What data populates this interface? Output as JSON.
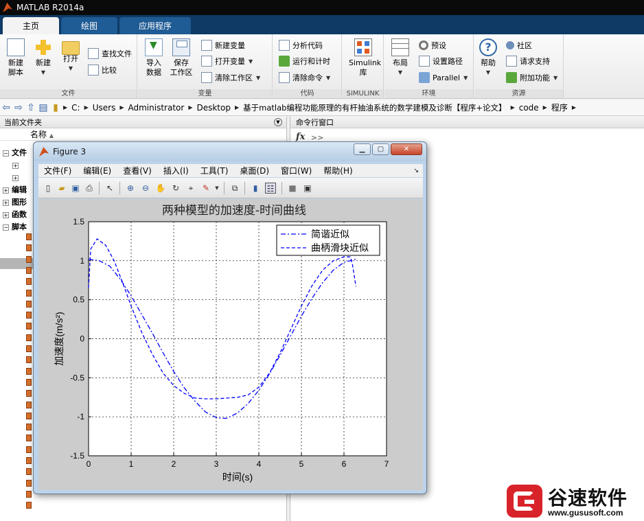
{
  "window": {
    "title": "MATLAB R2014a"
  },
  "tabs": [
    {
      "label": "主页",
      "active": true
    },
    {
      "label": "绘图",
      "active": false
    },
    {
      "label": "应用程序",
      "active": false
    }
  ],
  "ribbon": {
    "file": {
      "label": "文件",
      "new_script": "新建\n脚本",
      "new": "新建",
      "open": "打开",
      "find_files": "查找文件",
      "compare": "比较"
    },
    "variable": {
      "label": "变量",
      "import": "导入\n数据",
      "save_ws": "保存\n工作区",
      "new_var": "新建变量",
      "open_var": "打开变量",
      "clear_ws": "清除工作区"
    },
    "code": {
      "label": "代码",
      "analyze": "分析代码",
      "run_time": "运行和计时",
      "clear_cmd": "清除命令"
    },
    "simulink": {
      "label": "SIMULINK",
      "btn": "Simulink\n库"
    },
    "env": {
      "label": "环境",
      "layout": "布局",
      "prefs": "预设",
      "set_path": "设置路径",
      "parallel": "Parallel"
    },
    "resources": {
      "label": "资源",
      "help": "帮助",
      "community": "社区",
      "support": "请求支持",
      "addons": "附加功能"
    }
  },
  "address": {
    "crumbs": [
      "C:",
      "Users",
      "Administrator",
      "Desktop",
      "基于matlab编程功能原理的有杆抽油系统的数学建模及诊断【程序+论文】",
      "code",
      "程序"
    ]
  },
  "left_panel": {
    "title": "当前文件夹",
    "column_name": "名称",
    "sections": [
      "文件",
      "编辑",
      "图形",
      "函数",
      "脚本"
    ]
  },
  "right_panel": {
    "title": "命令行窗口",
    "fx": "fx",
    "prompt": ">>"
  },
  "figure": {
    "title": "Figure 3",
    "menus": [
      "文件(F)",
      "编辑(E)",
      "查看(V)",
      "插入(I)",
      "工具(T)",
      "桌面(D)",
      "窗口(W)",
      "帮助(H)"
    ]
  },
  "chart_data": {
    "type": "line",
    "title": "两种模型的加速度-时间曲线",
    "xlabel": "时间(s)",
    "ylabel": "加速度(m/s²)",
    "xlim": [
      0,
      7
    ],
    "ylim": [
      -1.5,
      1.5
    ],
    "xticks": [
      0,
      1,
      2,
      3,
      4,
      5,
      6,
      7
    ],
    "yticks": [
      -1.5,
      -1,
      -0.5,
      0,
      0.5,
      1,
      1.5
    ],
    "ytick_labels": [
      "-1.5",
      "-1",
      "-0.5",
      "0",
      "0.5",
      "1",
      "1.5"
    ],
    "grid": true,
    "legend_position": "top-right",
    "series": [
      {
        "name": "简谐近似",
        "style": "dashdot",
        "color": "#0000ff",
        "x": [
          0,
          0.25,
          0.5,
          0.75,
          1.0,
          1.25,
          1.5,
          1.75,
          2.0,
          2.25,
          2.5,
          2.75,
          3.0,
          3.14,
          3.25,
          3.5,
          3.75,
          4.0,
          4.25,
          4.5,
          4.75,
          5.0,
          5.25,
          5.5,
          5.75,
          6.0,
          6.28
        ],
        "y": [
          1.02,
          1.0,
          0.93,
          0.76,
          0.55,
          0.31,
          0.07,
          -0.18,
          -0.42,
          -0.63,
          -0.8,
          -0.94,
          -1.01,
          -1.02,
          -1.02,
          -0.95,
          -0.83,
          -0.66,
          -0.45,
          -0.21,
          0.04,
          0.29,
          0.52,
          0.72,
          0.88,
          0.98,
          1.02
        ]
      },
      {
        "name": "曲柄滑块近似",
        "style": "dashed",
        "color": "#0000ff",
        "x": [
          0,
          0.05,
          0.2,
          0.4,
          0.6,
          0.8,
          1.0,
          1.25,
          1.5,
          1.75,
          2.0,
          2.25,
          2.5,
          2.75,
          3.0,
          3.25,
          3.5,
          3.75,
          4.0,
          4.25,
          4.5,
          4.75,
          5.0,
          5.25,
          5.5,
          5.75,
          6.0,
          6.15,
          6.2,
          6.28
        ],
        "y": [
          0.65,
          1.15,
          1.28,
          1.2,
          1.0,
          0.72,
          0.42,
          0.08,
          -0.2,
          -0.44,
          -0.6,
          -0.7,
          -0.76,
          -0.77,
          -0.77,
          -0.76,
          -0.75,
          -0.72,
          -0.62,
          -0.44,
          -0.18,
          0.12,
          0.42,
          0.68,
          0.88,
          1.0,
          1.05,
          1.05,
          0.95,
          0.67
        ]
      }
    ]
  },
  "watermark": {
    "brand": "谷速软件",
    "url": "www.gususoft.com"
  }
}
